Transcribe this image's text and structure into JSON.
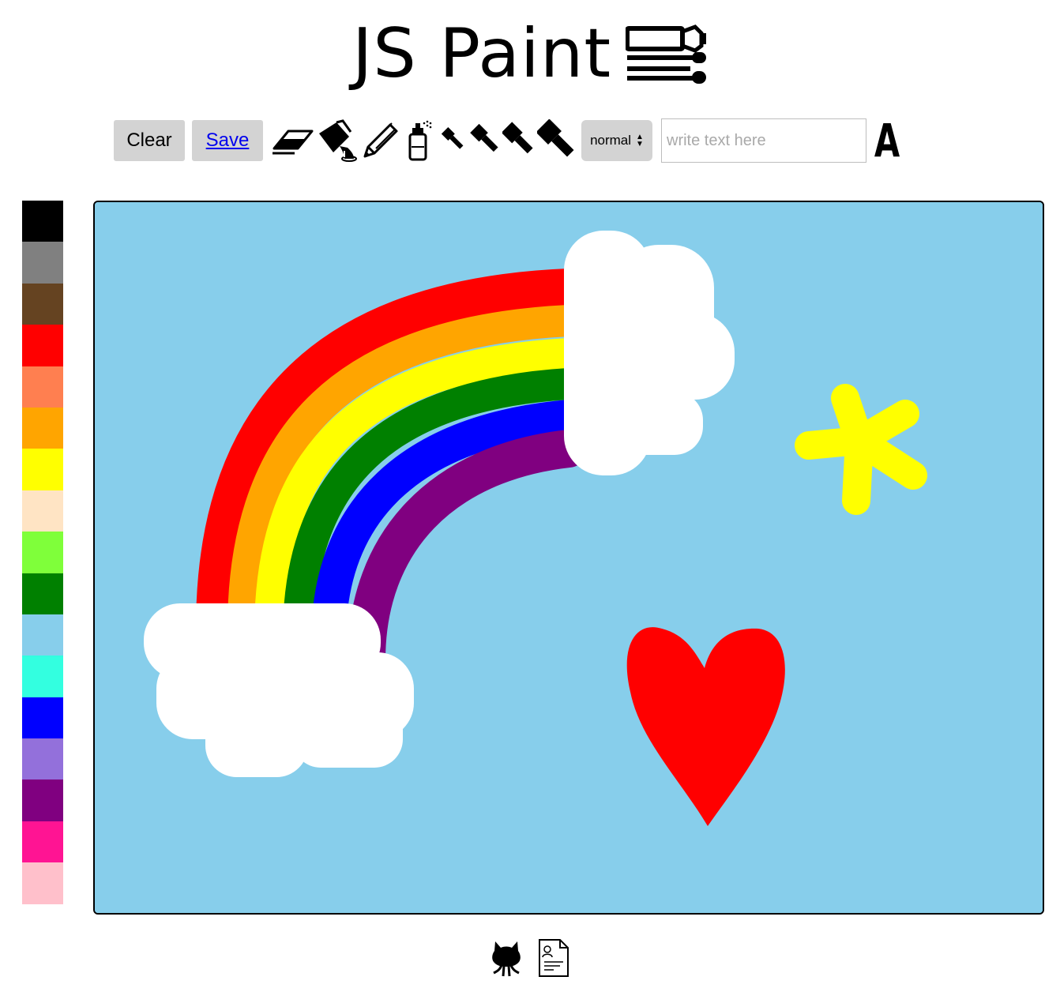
{
  "app": {
    "title": "JS Paint"
  },
  "toolbar": {
    "clear_label": "Clear",
    "save_label": "Save",
    "tools": [
      "eraser-icon",
      "paint-bucket-icon",
      "pencil-icon",
      "spray-can-icon",
      "brush-size-1-icon",
      "brush-size-2-icon",
      "brush-size-3-icon",
      "brush-size-4-icon"
    ],
    "blend_mode": "normal",
    "text_placeholder": "write text here",
    "font_button_label": "A"
  },
  "palette": {
    "colors": [
      "#000000",
      "#808080",
      "#654321",
      "#ff0000",
      "#ff7f50",
      "#ffa500",
      "#ffff00",
      "#ffe4c4",
      "#7fff3a",
      "#008000",
      "#87ceeb",
      "#33ffe0",
      "#0000ff",
      "#9370db",
      "#800080",
      "#ff1493",
      "#ffc0cb"
    ]
  },
  "canvas": {
    "background": "#87ceeb",
    "drawing": [
      "rainbow",
      "cloud",
      "cloud",
      "star",
      "heart"
    ]
  },
  "footer": {
    "links": [
      "github-icon",
      "resume-icon"
    ]
  }
}
